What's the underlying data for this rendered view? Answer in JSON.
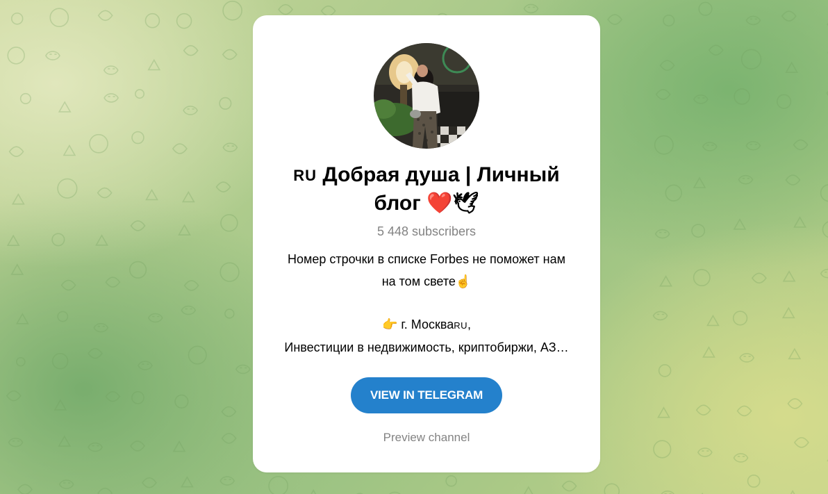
{
  "channel": {
    "flag": "RU",
    "name": "Добрая душа | Личный блог",
    "name_emoji": "❤️🕊",
    "subscribers": "5 448 subscribers"
  },
  "description": {
    "line1": "Номер строчки в списке Forbes не поможет нам",
    "line2": "на том свете☝️",
    "location_pointer": "👉",
    "location_text": "г. Москва",
    "location_flag": "RU",
    "location_suffix": ",",
    "line4": "Инвестиции в недвижимость, криптобиржи, АЗ…"
  },
  "actions": {
    "view_button": "VIEW IN TELEGRAM",
    "preview_link": "Preview channel"
  },
  "colors": {
    "accent": "#2481cc",
    "muted_text": "#838383",
    "card_bg": "#ffffff"
  }
}
